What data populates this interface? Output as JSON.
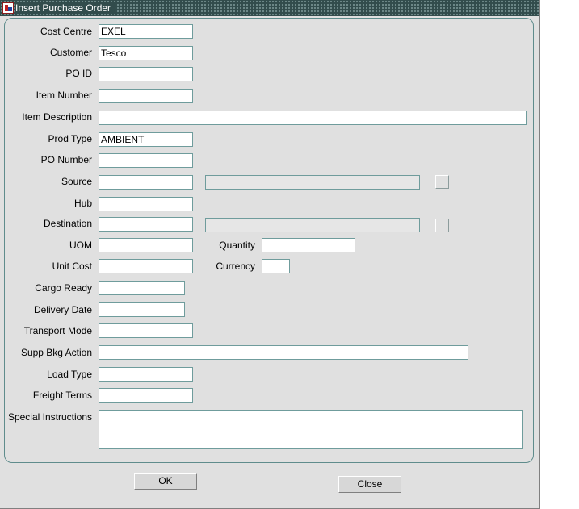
{
  "window": {
    "title": "Insert Purchase Order",
    "icon": "oracle-forms-icon"
  },
  "form": {
    "cost_centre": {
      "label": "Cost Centre",
      "value": "EXEL"
    },
    "customer": {
      "label": "Customer",
      "value": "Tesco"
    },
    "po_id": {
      "label": "PO ID",
      "value": ""
    },
    "item_number": {
      "label": "Item Number",
      "value": ""
    },
    "item_description": {
      "label": "Item Description",
      "value": ""
    },
    "prod_type": {
      "label": "Prod Type",
      "value": "AMBIENT"
    },
    "po_number": {
      "label": "PO Number",
      "value": ""
    },
    "source": {
      "label": "Source",
      "value": "",
      "description": ""
    },
    "hub": {
      "label": "Hub",
      "value": ""
    },
    "destination": {
      "label": "Destination",
      "value": "",
      "description": ""
    },
    "uom": {
      "label": "UOM",
      "value": ""
    },
    "quantity": {
      "label": "Quantity",
      "value": ""
    },
    "unit_cost": {
      "label": "Unit Cost",
      "value": ""
    },
    "currency": {
      "label": "Currency",
      "value": ""
    },
    "cargo_ready": {
      "label": "Cargo Ready",
      "value": ""
    },
    "delivery_date": {
      "label": "Delivery Date",
      "value": ""
    },
    "transport_mode": {
      "label": "Transport Mode",
      "value": ""
    },
    "supp_bkg_action": {
      "label": "Supp Bkg Action",
      "value": ""
    },
    "load_type": {
      "label": "Load Type",
      "value": ""
    },
    "freight_terms": {
      "label": "Freight Terms",
      "value": ""
    },
    "special_instructions": {
      "label": "Special Instructions",
      "value": ""
    }
  },
  "buttons": {
    "ok": "OK",
    "close": "Close"
  }
}
